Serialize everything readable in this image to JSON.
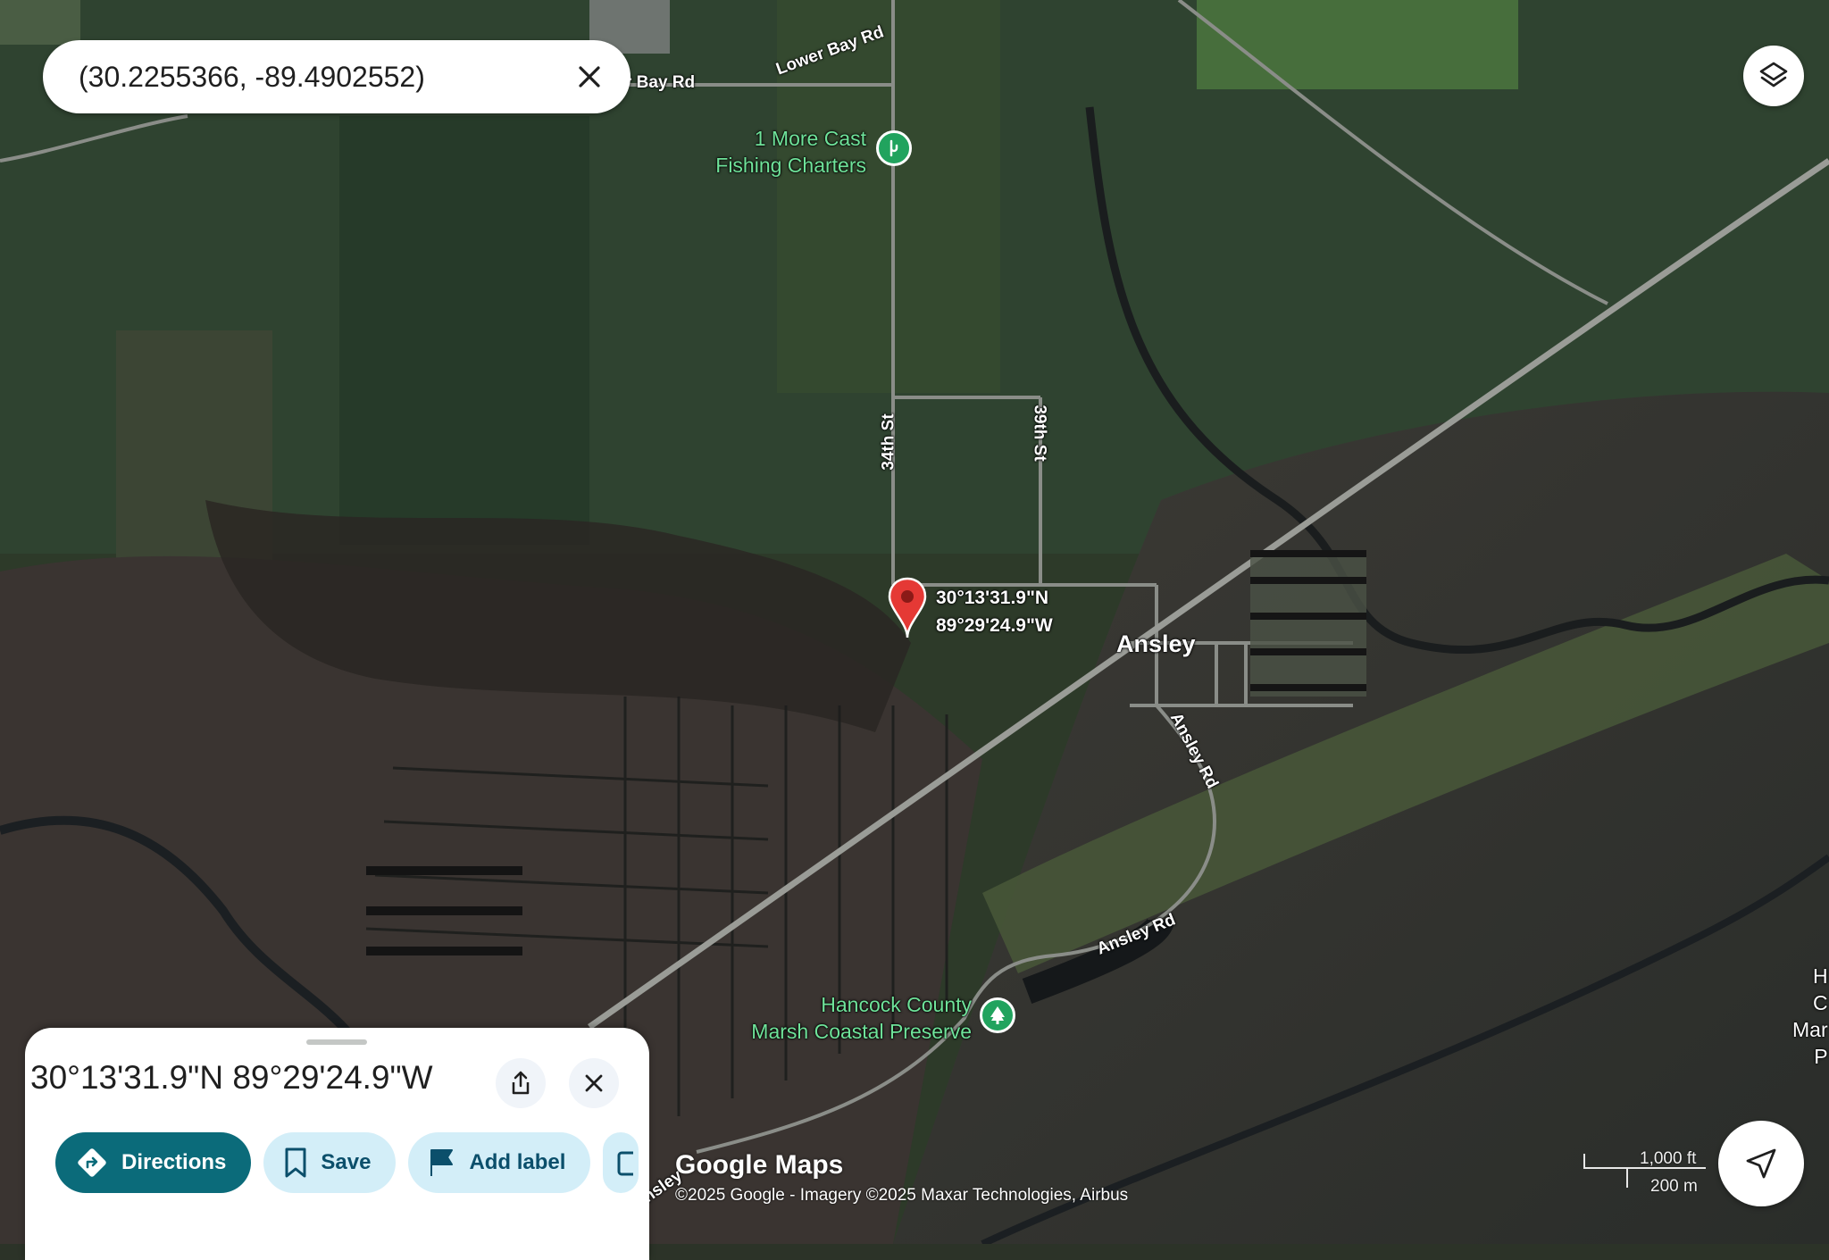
{
  "search": {
    "query": "(30.2255366, -89.4902552)"
  },
  "map": {
    "roads": {
      "bay_rd": "r Bay Rd",
      "lower_bay_rd": "Lower Bay Rd",
      "st_34": "34th St",
      "st_39": "39th St",
      "ansley_rd_1": "Ansley Rd",
      "ansley_rd_2": "Ansley Rd",
      "ansley_rd_3": "nsley"
    },
    "places": {
      "fishing_line1": "1 More Cast",
      "fishing_line2": "Fishing Charters",
      "town": "Ansley",
      "preserve_line1": "Hancock County",
      "preserve_line2": "Marsh Coastal Preserve",
      "edge_label_1": "H",
      "edge_label_2": "C",
      "edge_label_3": "Mar",
      "edge_label_4": "P"
    },
    "pin": {
      "lat": "30°13'31.9\"N",
      "lng": "89°29'24.9\"W"
    },
    "scale": {
      "imperial": "1,000 ft",
      "metric": "200 m"
    },
    "logo": "Google Maps",
    "attribution": "©2025 Google - Imagery ©2025 Maxar Technologies, Airbus"
  },
  "sheet": {
    "title": "30°13'31.9\"N 89°29'24.9\"W",
    "actions": {
      "directions": "Directions",
      "save": "Save",
      "add_label": "Add label"
    }
  },
  "colors": {
    "accent_teal": "#0b6b7a",
    "chip_light": "#d3eef8",
    "pin_red": "#e53935",
    "poi_green": "#21a35e"
  },
  "icons": [
    "close-icon",
    "layers-icon",
    "share-icon",
    "directions-icon",
    "bookmark-icon",
    "flag-icon",
    "navigation-arrow-icon",
    "tree-icon",
    "fishing-icon"
  ]
}
